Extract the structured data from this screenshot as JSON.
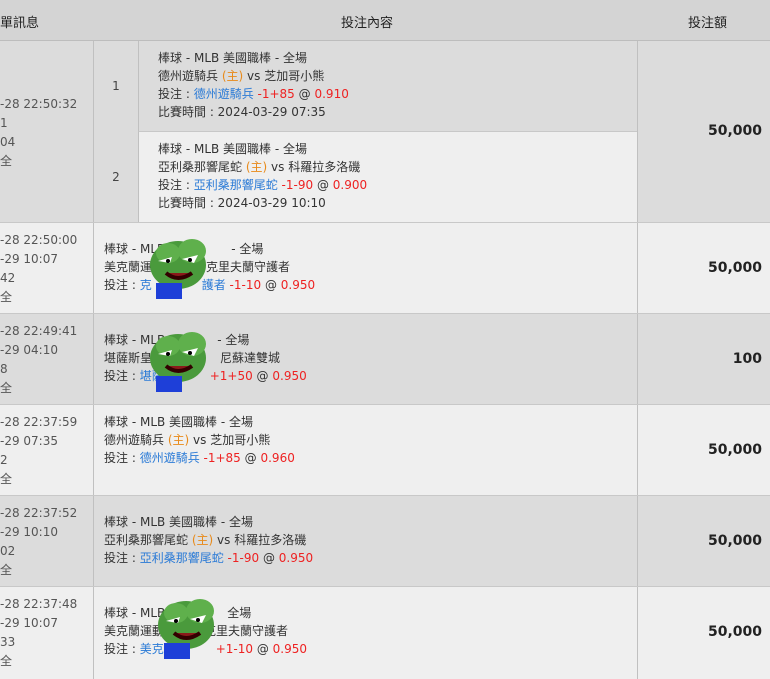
{
  "header": {
    "col1": "單訊息",
    "col2": "投注內容",
    "col3": "投注額"
  },
  "rows": [
    {
      "info": [
        "-28 22:50:32",
        "1",
        "04",
        "全"
      ],
      "amount": "50,000",
      "parlay": [
        {
          "index": "1",
          "league": "棒球 - MLB 美國職棒 - 全場",
          "home": "德州遊騎兵",
          "home_tag": "(主)",
          "vs": "vs",
          "away": "芝加哥小熊",
          "bet_prefix": "投注 :",
          "bet_team": "德州遊騎兵",
          "handicap": "-1+85",
          "at": "@",
          "odds": "0.910",
          "time_label": "比賽時間 : 2024-03-29 07:35"
        },
        {
          "index": "2",
          "league": "棒球 - MLB 美國職棒 - 全場",
          "home": "亞利桑那響尾蛇",
          "home_tag": "(主)",
          "vs": "vs",
          "away": "科羅拉多洛磯",
          "bet_prefix": "投注 :",
          "bet_team": "亞利桑那響尾蛇",
          "handicap": "-1-90",
          "at": "@",
          "odds": "0.900",
          "time_label": "比賽時間 : 2024-03-29 10:10"
        }
      ]
    },
    {
      "info": [
        "-28 22:50:00",
        "-29 10:07",
        "42",
        "全"
      ],
      "amount": "50,000",
      "league": "棒球 - MLB",
      "league_tail": "- 全場",
      "match_a": "美克蘭運",
      "match_b": "克里夫蘭守護者",
      "bet_prefix": "投注 :",
      "bet_team_a": "克",
      "bet_team_b": "護者",
      "handicap": "-1-10",
      "at": "@",
      "odds": "0.950"
    },
    {
      "info": [
        "-28 22:49:41",
        "-29 04:10",
        "8",
        "全"
      ],
      "amount": "100",
      "league": "棒球 - MLB",
      "league_tail": "- 全場",
      "match_a": "堪薩斯皇家",
      "match_b": "尼蘇達雙城",
      "bet_prefix": "投注 :",
      "bet_team_a": "堪薩",
      "handicap": "+1+50",
      "at": "@",
      "odds": "0.950"
    },
    {
      "info": [
        "-28 22:37:59",
        "-29 07:35",
        "2",
        "全"
      ],
      "amount": "50,000",
      "league": "棒球 - MLB 美國職棒 - 全場",
      "home": "德州遊騎兵",
      "home_tag": "(主)",
      "vs": "vs",
      "away": "芝加哥小熊",
      "bet_prefix": "投注 :",
      "bet_team": "德州遊騎兵",
      "handicap": "-1+85",
      "at": "@",
      "odds": "0.960"
    },
    {
      "info": [
        "-28 22:37:52",
        "-29 10:10",
        "02",
        "全"
      ],
      "amount": "50,000",
      "league": "棒球 - MLB 美國職棒 - 全場",
      "home": "亞利桑那響尾蛇",
      "home_tag": "(主)",
      "vs": "vs",
      "away": "科羅拉多洛磯",
      "bet_prefix": "投注 :",
      "bet_team": "亞利桑那響尾蛇",
      "handicap": "-1-90",
      "at": "@",
      "odds": "0.950"
    },
    {
      "info": [
        "-28 22:37:48",
        "-29 10:07",
        "33",
        "全"
      ],
      "amount": "50,000",
      "league": "棒球 - MLB",
      "league_tail": "全場",
      "match_a": "美克蘭運動",
      "match_b": "克里夫蘭守護者",
      "bet_prefix": "投注 :",
      "bet_team_a": "美克",
      "handicap": "+1-10",
      "at": "@",
      "odds": "0.950"
    }
  ],
  "colors": {
    "header_bg": "#d4d4d4",
    "row_dark": "#dcdcdc",
    "row_light": "#efefef",
    "team_blue": "#2a7ad6",
    "odds_red": "#ee2222",
    "home_orange": "#e88a1a"
  },
  "icons": [
    "frog-sticker-icon"
  ]
}
